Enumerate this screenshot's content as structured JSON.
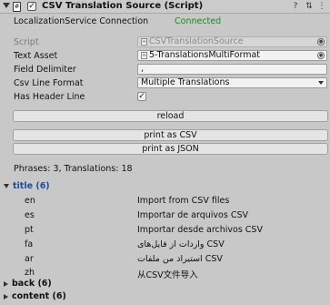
{
  "header": {
    "title": "CSV Translation Source (Script)",
    "icons": [
      "help-icon",
      "preset-icon",
      "more-menu-icon"
    ]
  },
  "connection": {
    "label": "LocalizationService Connection",
    "status": "Connected",
    "status_color": "#1a8a1a"
  },
  "fields": {
    "script_label": "Script",
    "script_value": "CSVTranslationSource",
    "text_asset_label": "Text Asset",
    "text_asset_value": "5-TranslationsMultiFormat",
    "delimiter_label": "Field Delimiter",
    "delimiter_value": ",",
    "line_format_label": "Csv Line Format",
    "line_format_value": "Multiple Translations",
    "header_line_label": "Has Header Line",
    "header_line_checked": true
  },
  "buttons": {
    "reload": "reload",
    "print_csv": "print as CSV",
    "print_json": "print as JSON"
  },
  "summary": "Phrases: 3, Translations: 18",
  "phrases": {
    "title_label": "title (6)",
    "title_color": "#1f4c9c",
    "translations": [
      {
        "lang": "en",
        "text": "Import from CSV files"
      },
      {
        "lang": "es",
        "text": "Importar de arquivos CSV"
      },
      {
        "lang": "pt",
        "text": "Importar desde archivos CSV"
      },
      {
        "lang": "fa",
        "text": "واردات از فایل‌های CSV"
      },
      {
        "lang": "ar",
        "text": "استيراد من ملفات CSV"
      },
      {
        "lang": "zh",
        "text": "从CSV文件导入"
      }
    ],
    "back_label": "back (6)",
    "content_label": "content (6)"
  }
}
